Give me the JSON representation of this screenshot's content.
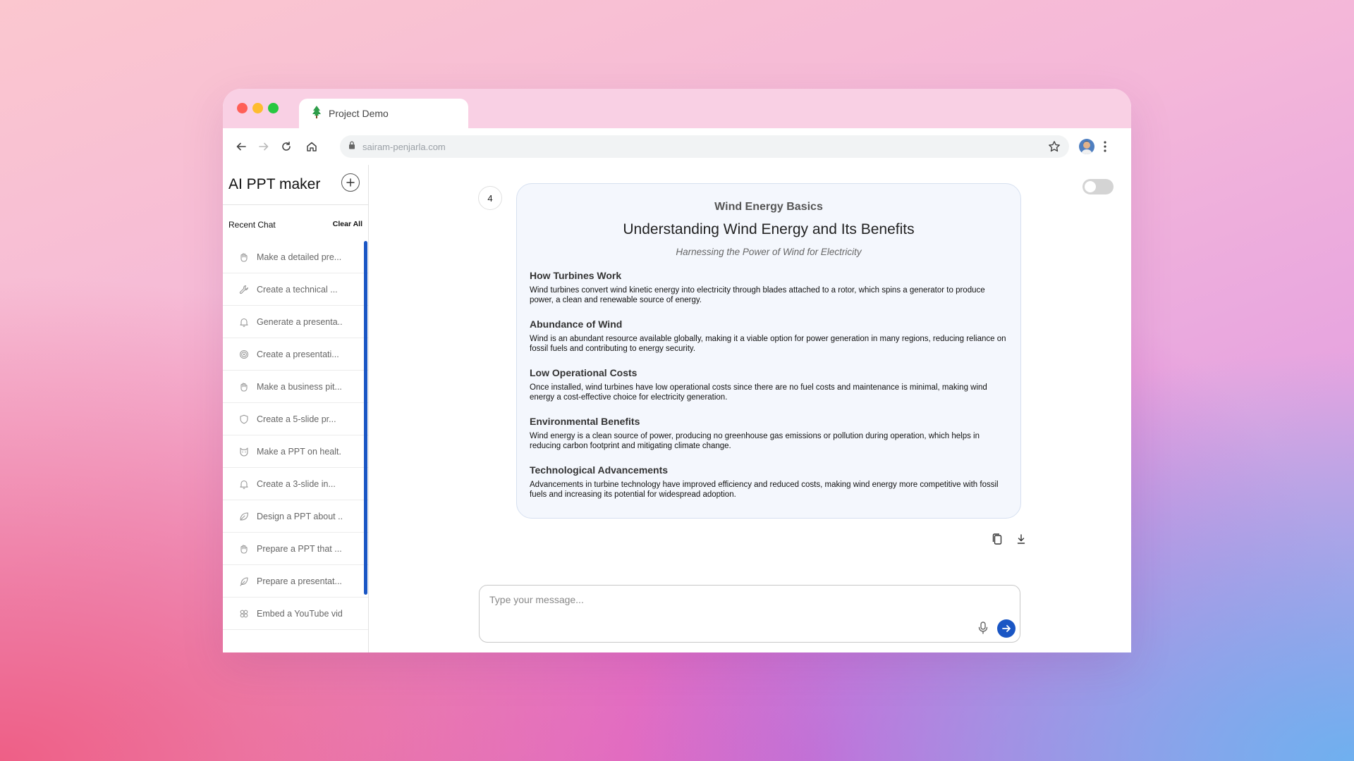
{
  "browser": {
    "tab_title": "Project Demo",
    "url": "sairam-penjarla.com",
    "traffic_lights": [
      "#ff5f57",
      "#febc2e",
      "#28c840"
    ]
  },
  "sidebar": {
    "app_title": "AI PPT maker",
    "recent_label": "Recent Chat",
    "clear_all": "Clear All",
    "chats": [
      {
        "icon": "hand-icon",
        "text": "Make a detailed pre..."
      },
      {
        "icon": "wrench-icon",
        "text": "Create a technical ..."
      },
      {
        "icon": "bell-icon",
        "text": "Generate a presenta.."
      },
      {
        "icon": "target-icon",
        "text": "Create a presentati..."
      },
      {
        "icon": "hand-icon",
        "text": "Make a business pit..."
      },
      {
        "icon": "shield-icon",
        "text": "Create a 5-slide pr..."
      },
      {
        "icon": "cat-icon",
        "text": "Make a PPT on healt."
      },
      {
        "icon": "bell-icon",
        "text": "Create a 3-slide in..."
      },
      {
        "icon": "leaf-icon",
        "text": "Design a PPT about .."
      },
      {
        "icon": "hand-icon",
        "text": "Prepare a PPT that ..."
      },
      {
        "icon": "feather-icon",
        "text": "Prepare a presentat..."
      },
      {
        "icon": "flower-icon",
        "text": "Embed a YouTube vid"
      }
    ]
  },
  "main": {
    "slide_number": "4",
    "slide": {
      "kicker": "Wind Energy Basics",
      "title": "Understanding Wind Energy and Its Benefits",
      "subtitle": "Harnessing the Power of Wind for Electricity",
      "sections": [
        {
          "heading": "How Turbines Work",
          "body": "Wind turbines convert wind kinetic energy into electricity through blades attached to a rotor, which spins a generator to produce power, a clean and renewable source of energy."
        },
        {
          "heading": "Abundance of Wind",
          "body": "Wind is an abundant resource available globally, making it a viable option for power generation in many regions, reducing reliance on fossil fuels and contributing to energy security."
        },
        {
          "heading": "Low Operational Costs",
          "body": "Once installed, wind turbines have low operational costs since there are no fuel costs and maintenance is minimal, making wind energy a cost-effective choice for electricity generation."
        },
        {
          "heading": "Environmental Benefits",
          "body": "Wind energy is a clean source of power, producing no greenhouse gas emissions or pollution during operation, which helps in reducing carbon footprint and mitigating climate change."
        },
        {
          "heading": "Technological Advancements",
          "body": "Advancements in turbine technology have improved efficiency and reduced costs, making wind energy more competitive with fossil fuels and increasing its potential for widespread adoption."
        }
      ]
    },
    "input_placeholder": "Type your message...",
    "accent_color": "#1a56c4"
  }
}
